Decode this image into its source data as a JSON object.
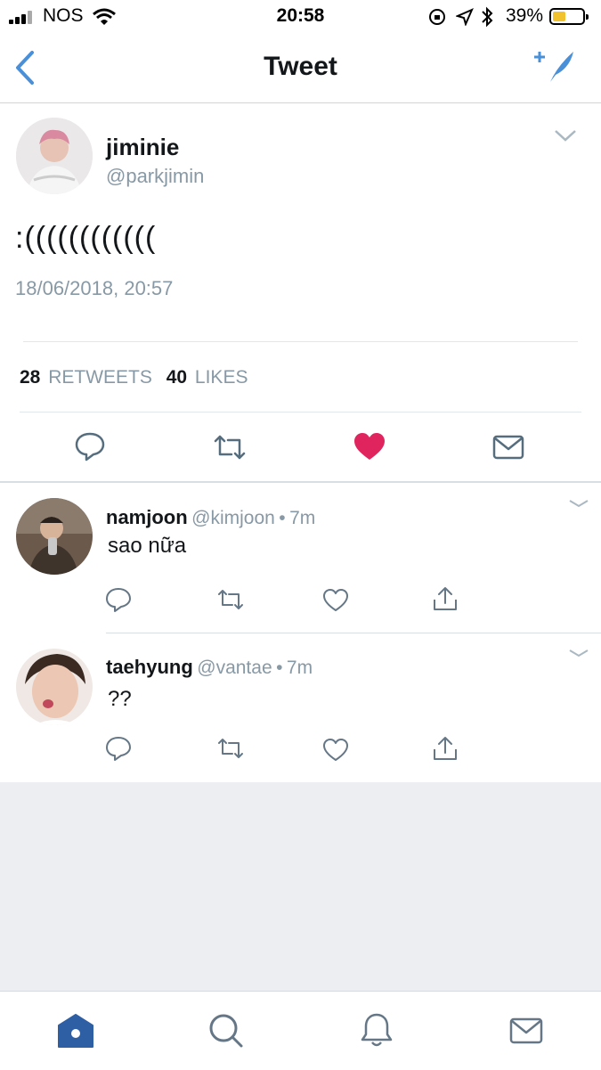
{
  "status_bar": {
    "carrier": "NOS",
    "time": "20:58",
    "battery_percent": "39%"
  },
  "nav": {
    "title": "Tweet",
    "back_icon": "chevron-left-icon",
    "compose_icon": "compose-feather-icon"
  },
  "main_tweet": {
    "display_name": "jiminie",
    "handle": "@parkjimin",
    "text": ":((((((((((((",
    "timestamp": "18/06/2018, 20:57",
    "retweets_count": "28",
    "retweets_label": "RETWEETS",
    "likes_count": "40",
    "likes_label": "LIKES",
    "liked": true
  },
  "replies": [
    {
      "display_name": "namjoon",
      "handle": "@kimjoon",
      "time": "7m",
      "text": "sao nữa"
    },
    {
      "display_name": "taehyung",
      "handle": "@vantae",
      "time": "7m",
      "text": "??"
    }
  ],
  "tab_bar": {
    "tabs": [
      "home-icon",
      "search-icon",
      "notifications-icon",
      "messages-icon"
    ]
  },
  "colors": {
    "accent": "#4a90d9",
    "like": "#e0245e",
    "muted": "#8899a6",
    "text": "#14171a"
  }
}
